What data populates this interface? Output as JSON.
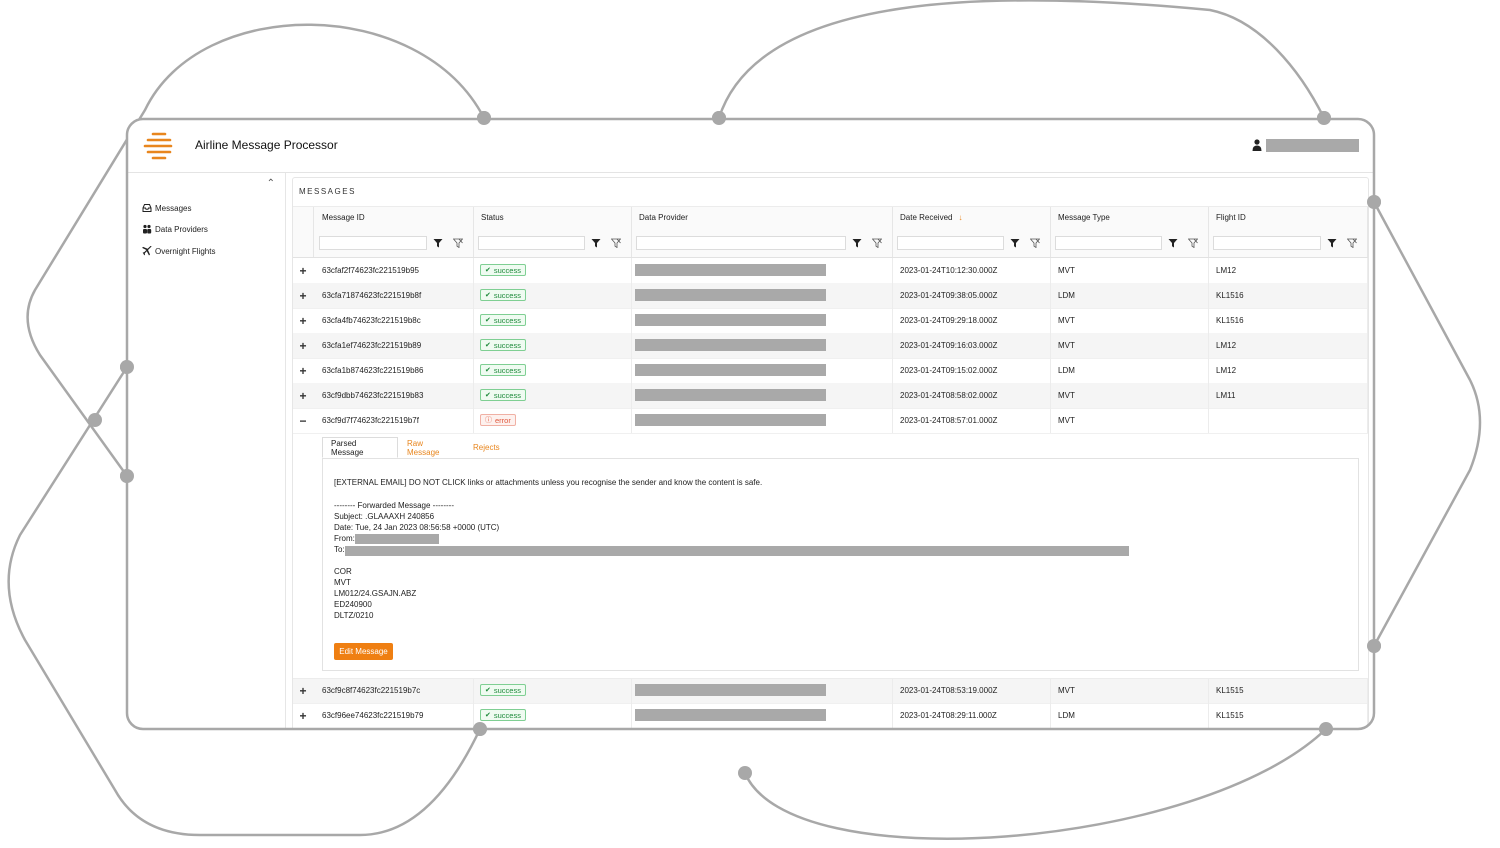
{
  "app": {
    "title": "Airline Message Processor"
  },
  "sidebar": {
    "items": [
      {
        "label": "Messages",
        "icon": "inbox-icon"
      },
      {
        "label": "Data Providers",
        "icon": "users-icon"
      },
      {
        "label": "Overnight Flights",
        "icon": "plane-icon"
      }
    ]
  },
  "messages": {
    "title": "MESSAGES",
    "columns": [
      "Message ID",
      "Status",
      "Data Provider",
      "Date Received",
      "Message Type",
      "Flight ID"
    ],
    "sorted_column": "Date Received",
    "sort_direction": "descending",
    "rows": [
      {
        "id": "63cfaf2f74623fc221519b95",
        "status": "success",
        "received": "2023-01-24T10:12:30.000Z",
        "type": "MVT",
        "flight": "LM12"
      },
      {
        "id": "63cfa71874623fc221519b8f",
        "status": "success",
        "received": "2023-01-24T09:38:05.000Z",
        "type": "LDM",
        "flight": "KL1516"
      },
      {
        "id": "63cfa4fb74623fc221519b8c",
        "status": "success",
        "received": "2023-01-24T09:29:18.000Z",
        "type": "MVT",
        "flight": "KL1516"
      },
      {
        "id": "63cfa1ef74623fc221519b89",
        "status": "success",
        "received": "2023-01-24T09:16:03.000Z",
        "type": "MVT",
        "flight": "LM12"
      },
      {
        "id": "63cfa1b874623fc221519b86",
        "status": "success",
        "received": "2023-01-24T09:15:02.000Z",
        "type": "LDM",
        "flight": "LM12"
      },
      {
        "id": "63cf9dbb74623fc221519b83",
        "status": "success",
        "received": "2023-01-24T08:58:02.000Z",
        "type": "MVT",
        "flight": "LM11"
      },
      {
        "id": "63cf9d7f74623fc221519b7f",
        "status": "error",
        "received": "2023-01-24T08:57:01.000Z",
        "type": "MVT",
        "flight": ""
      },
      {
        "id": "63cf9c8f74623fc221519b7c",
        "status": "success",
        "received": "2023-01-24T08:53:19.000Z",
        "type": "MVT",
        "flight": "KL1515"
      },
      {
        "id": "63cf96ee74623fc221519b79",
        "status": "success",
        "received": "2023-01-24T08:29:11.000Z",
        "type": "LDM",
        "flight": "KL1515"
      }
    ]
  },
  "detail": {
    "tabs": [
      "Parsed Message",
      "Raw Message",
      "Rejects"
    ],
    "active_tab": "Parsed Message",
    "warning": "[EXTERNAL EMAIL] DO NOT CLICK links or attachments unless you recognise the sender and know the content is safe.",
    "forwarded": "-------- Forwarded Message --------",
    "subject": "Subject: .GLAAAXH 240856",
    "date": "Date: Tue, 24 Jan 2023 08:56:58 +0000 (UTC)",
    "from_label": "From:",
    "to_label": "To:",
    "body": [
      "COR",
      "MVT",
      "LM012/24.GSAJN.ABZ",
      "ED240900",
      "DLTZ/0210"
    ],
    "edit_label": "Edit Message"
  },
  "colors": {
    "accent": "#EF7F12",
    "success": "#1D8A3A",
    "error": "#E0583E",
    "redaction": "#A9A9A9"
  }
}
